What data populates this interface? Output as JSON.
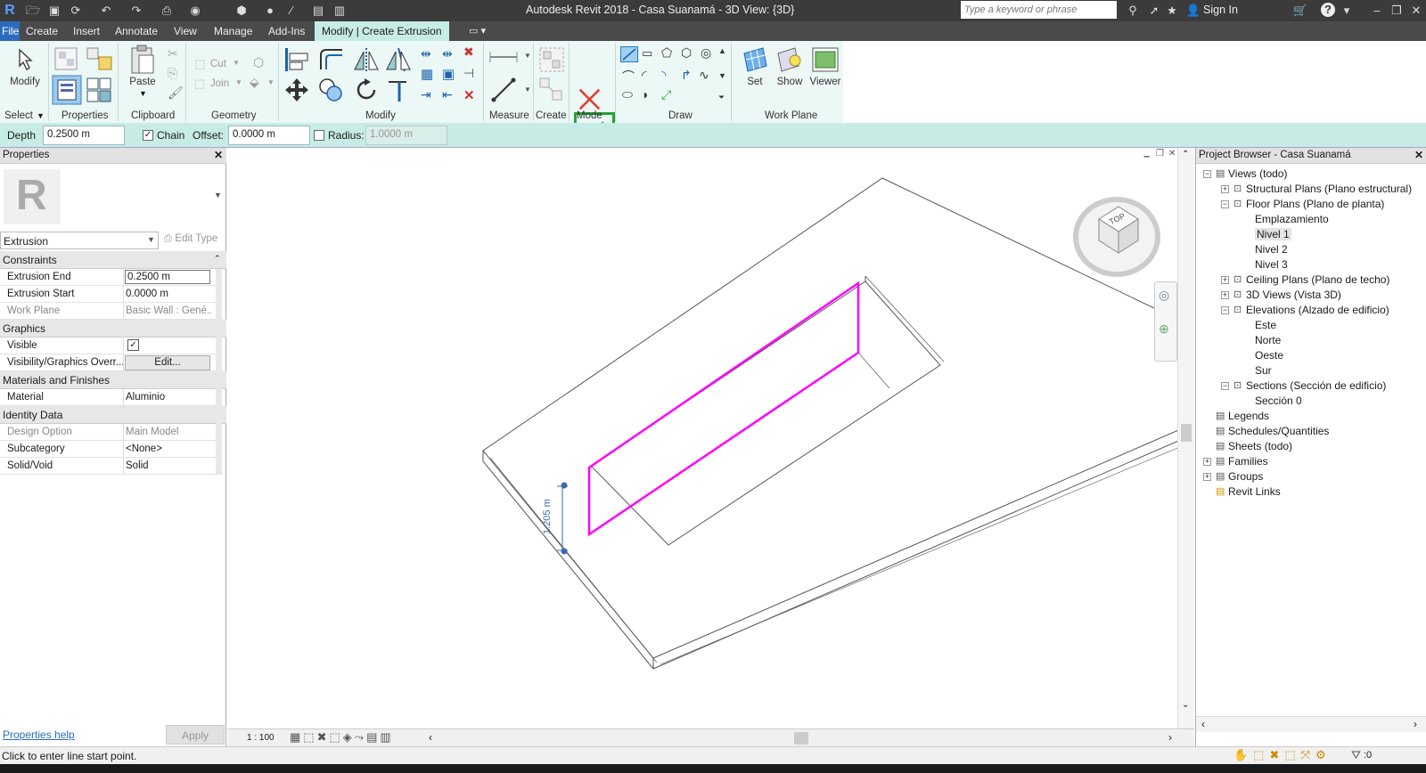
{
  "titlebar": {
    "title": "Autodesk Revit 2018 -     Casa Suanamá - 3D View: {3D}",
    "search_placeholder": "Type a keyword or phrase",
    "sign_in": "Sign In"
  },
  "tabs": [
    "File",
    "Create",
    "Insert",
    "Annotate",
    "View",
    "Manage",
    "Add-Ins",
    "Modify | Create Extrusion"
  ],
  "ribbon": {
    "modify_label": "Modify",
    "paste_label": "Paste",
    "cut_label": "Cut",
    "join_label": "Join",
    "set_label": "Set",
    "show_label": "Show",
    "viewer_label": "Viewer",
    "panels": {
      "select": "Select",
      "properties": "Properties",
      "clipboard": "Clipboard",
      "geometry": "Geometry",
      "modify": "Modify",
      "measure": "Measure",
      "create": "Create",
      "mode": "Mode",
      "draw": "Draw",
      "work_plane": "Work Plane"
    }
  },
  "options_bar": {
    "depth_label": "Depth",
    "depth_value": "0.2500 m",
    "chain_label": "Chain",
    "chain_checked": true,
    "offset_label": "Offset:",
    "offset_value": "0.0000 m",
    "radius_label": "Radius:",
    "radius_checked": false,
    "radius_value": "1.0000 m"
  },
  "properties": {
    "title": "Properties",
    "type": "Extrusion",
    "edit_type": "Edit Type",
    "groups": [
      {
        "name": "Constraints",
        "rows": [
          {
            "key": "Extrusion End",
            "value": "0.2500 m"
          },
          {
            "key": "Extrusion Start",
            "value": "0.0000 m"
          },
          {
            "key": "Work Plane",
            "value": "Basic Wall : Gené..."
          }
        ]
      },
      {
        "name": "Graphics",
        "rows": [
          {
            "key": "Visible",
            "value": "✓"
          },
          {
            "key": "Visibility/Graphics Overr...",
            "value": "Edit..."
          }
        ]
      },
      {
        "name": "Materials and Finishes",
        "rows": [
          {
            "key": "Material",
            "value": "Aluminio"
          }
        ]
      },
      {
        "name": "Identity Data",
        "rows": [
          {
            "key": "Design Option",
            "value": "Main Model"
          },
          {
            "key": "Subcategory",
            "value": "<None>"
          },
          {
            "key": "Solid/Void",
            "value": "Solid"
          }
        ]
      }
    ],
    "help_link": "Properties help",
    "apply": "Apply"
  },
  "viewport": {
    "dimension_text": "1.205 m",
    "viewcube_top": "TOP",
    "scale": "1 : 100"
  },
  "project_browser": {
    "title": "Project Browser - Casa Suanamá",
    "items": [
      {
        "label": "Views (todo)",
        "level": 0,
        "box": "−"
      },
      {
        "label": "Structural Plans (Plano estructural)",
        "level": 1,
        "box": "+"
      },
      {
        "label": "Floor Plans (Plano de planta)",
        "level": 1,
        "box": "−"
      },
      {
        "label": "Emplazamiento",
        "level": 2,
        "box": ""
      },
      {
        "label": "Nivel 1",
        "level": 2,
        "box": "",
        "selected": true
      },
      {
        "label": "Nivel 2",
        "level": 2,
        "box": ""
      },
      {
        "label": "Nivel 3",
        "level": 2,
        "box": ""
      },
      {
        "label": "Ceiling Plans (Plano de techo)",
        "level": 1,
        "box": "+"
      },
      {
        "label": "3D Views (Vista 3D)",
        "level": 1,
        "box": "+"
      },
      {
        "label": "Elevations (Alzado de edificio)",
        "level": 1,
        "box": "−"
      },
      {
        "label": "Este",
        "level": 2,
        "box": ""
      },
      {
        "label": "Norte",
        "level": 2,
        "box": ""
      },
      {
        "label": "Oeste",
        "level": 2,
        "box": ""
      },
      {
        "label": "Sur",
        "level": 2,
        "box": ""
      },
      {
        "label": "Sections (Sección de edificio)",
        "level": 1,
        "box": "−"
      },
      {
        "label": "Sección 0",
        "level": 2,
        "box": ""
      },
      {
        "label": "Legends",
        "level": 0,
        "box": ""
      },
      {
        "label": "Schedules/Quantities",
        "level": 0,
        "box": ""
      },
      {
        "label": "Sheets (todo)",
        "level": 0,
        "box": ""
      },
      {
        "label": "Families",
        "level": 0,
        "box": "+"
      },
      {
        "label": "Groups",
        "level": 0,
        "box": "+"
      },
      {
        "label": "Revit Links",
        "level": 0,
        "box": ""
      }
    ]
  },
  "status": {
    "message": "Click to enter line start point.",
    "filter_count": ":0"
  },
  "colors": {
    "sketch_line": "#ff00ff",
    "highlight": "#21a336",
    "accent": "#2a6bbf"
  }
}
